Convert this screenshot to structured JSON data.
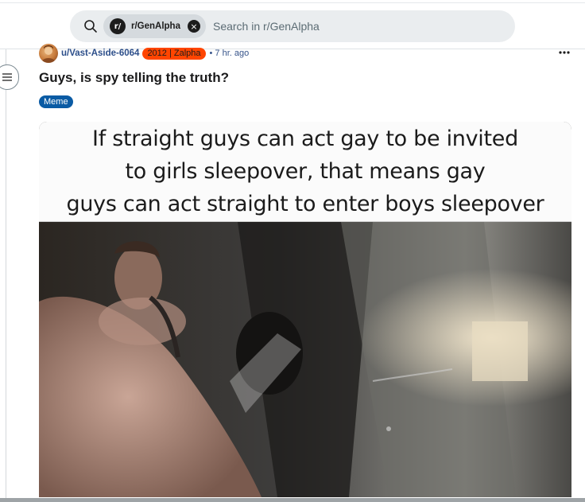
{
  "search": {
    "chip_avatar": "r/",
    "chip_label": "r/GenAlpha",
    "placeholder": "Search in r/GenAlpha"
  },
  "post": {
    "author": "u/Vast-Aside-6064",
    "flair": "2012 | Zalpha",
    "time": "• 7 hr. ago",
    "title": "Guys, is spy telling the truth?",
    "tag": "Meme",
    "caption_lines": [
      "If straight guys can act gay to be invited",
      "to girls sleepover, that means gay",
      "guys can act straight to enter boys sleepover"
    ]
  },
  "colors": {
    "flair_bg": "#ff4500",
    "tag_bg": "#0a5ba4",
    "username": "#2c4e8a",
    "search_bg": "#eaedef"
  },
  "icons": {
    "search": "search-icon",
    "close": "close-icon",
    "more": "more-options-icon",
    "thread": "thread-collapse-icon"
  }
}
